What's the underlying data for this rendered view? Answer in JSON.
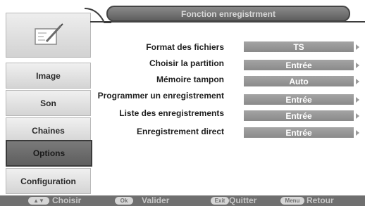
{
  "title": "Fonction enregistrment",
  "sidebar": {
    "logo_icon": "recording-note-icon",
    "items": [
      {
        "label": "Image"
      },
      {
        "label": "Son"
      },
      {
        "label": "Chaines"
      },
      {
        "label": "Options",
        "selected": true
      },
      {
        "label": "Configuration"
      }
    ]
  },
  "settings": [
    {
      "label": "Format des fichiers",
      "value": "TS"
    },
    {
      "label": "Choisir la partition",
      "value": "Entrée"
    },
    {
      "label": "Mémoire tampon",
      "value": "Auto"
    },
    {
      "label": "Programmer un enregistrement",
      "value": "Entrée"
    },
    {
      "label": "Liste des enregistrements",
      "value": "Entrée"
    },
    {
      "label": "Enregistrement direct",
      "value": "Entrée"
    }
  ],
  "footer": {
    "nav": {
      "key": "▲▼",
      "label": "Choisir"
    },
    "ok": {
      "key": "Ok",
      "label": "Valider"
    },
    "exit": {
      "key": "Exit",
      "label": "Quitter"
    },
    "menu": {
      "key": "Menu",
      "label": "Retour"
    }
  }
}
